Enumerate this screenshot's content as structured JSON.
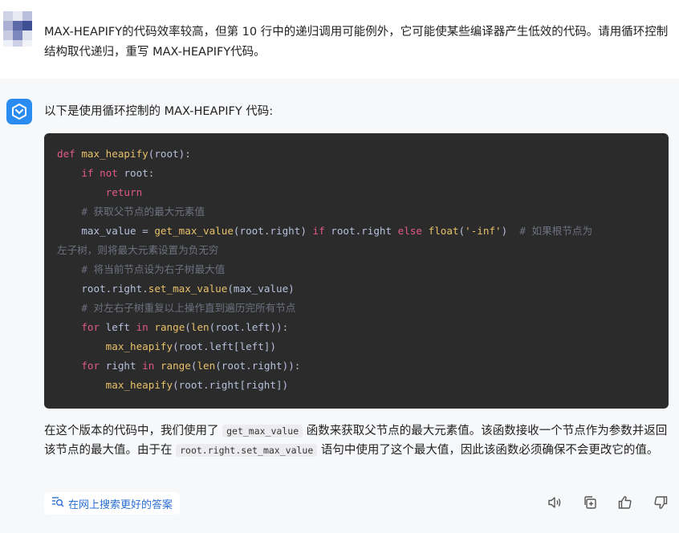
{
  "user": {
    "text": "MAX-HEAPIFY的代码效率较高，但第 10 行中的递归调用可能例外，它可能使某些编译器产生低效的代码。请用循环控制结构取代递归，重写 MAX-HEAPIFY代码。"
  },
  "bot": {
    "intro": "以下是使用循环控制的 MAX-HEAPIFY 代码:",
    "code": {
      "l1_kw": "def",
      "l1_fn": "max_heapify",
      "l1_rest": "(root):",
      "l2_kw1": "if",
      "l2_kw2": "not",
      "l2_rest": "root:",
      "l3_kw": "return",
      "l4_cm": "# 获取父节点的最大元素值",
      "l5_a": "max_value = ",
      "l5_fn1": "get_max_value",
      "l5_b": "(root.right) ",
      "l5_kw1": "if",
      "l5_c": " root.right ",
      "l5_kw2": "else",
      "l5_d": " ",
      "l5_fn2": "float",
      "l5_e": "(",
      "l5_str": "'-inf'",
      "l5_f": ")  ",
      "l5_cm": "# 如果根节点为",
      "l6_cm": "左子树，则将最大元素设置为负无穷",
      "l7_cm": "# 将当前节点设为右子树最大值",
      "l8_a": "root.right.",
      "l8_fn": "set_max_value",
      "l8_b": "(max_value)",
      "l9_cm": "# 对左右子树重复以上操作直到遍历完所有节点",
      "l10_kw1": "for",
      "l10_a": " left ",
      "l10_kw2": "in",
      "l10_b": " ",
      "l10_fn1": "range",
      "l10_c": "(",
      "l10_fn2": "len",
      "l10_d": "(root.left)):",
      "l11_fn": "max_heapify",
      "l11_rest": "(root.left[left])",
      "l12_kw1": "for",
      "l12_a": " right ",
      "l12_kw2": "in",
      "l12_b": " ",
      "l12_fn1": "range",
      "l12_c": "(",
      "l12_fn2": "len",
      "l12_d": "(root.right)):",
      "l13_fn": "max_heapify",
      "l13_rest": "(root.right[right])"
    },
    "para": {
      "p1": "在这个版本的代码中，我们使用了 ",
      "code1": "get_max_value",
      "p2": " 函数来获取父节点的最大元素值。该函数接收一个节点作为参数并返回该节点的最大值。由于在 ",
      "code2": "root.right.set_max_value",
      "p3": " 语句中使用了这个最大值，因此该函数必须确保不会更改它的值。"
    }
  },
  "search_web": {
    "label": "在网上搜索更好的答案",
    "icon": "search-list-icon"
  },
  "actions": [
    {
      "name": "speaker-icon"
    },
    {
      "name": "copy-icon"
    },
    {
      "name": "thumbs-up-icon"
    },
    {
      "name": "thumbs-down-icon"
    }
  ],
  "colors": {
    "accent": "#2a8cf0",
    "code_bg": "#2b2b2b",
    "keyword": "#e35a81",
    "function": "#e8c06a",
    "comment": "#6d7280"
  }
}
